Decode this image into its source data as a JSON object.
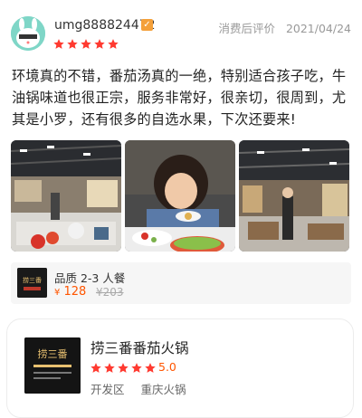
{
  "review": {
    "username": "umg888824472",
    "badge_icon": "vip-badge-icon",
    "meta_label": "消费后评价",
    "date": "2021/04/24",
    "rating": 5,
    "text": "环境真的不错，番茄汤真的一绝，特别适合孩子吃，牛油锅味道也很正宗，服务非常好，很亲切，很周到，尤其是小罗，还有很多的自选水果，下次还要来!",
    "photos": [
      "restaurant-interior-photo",
      "child-eating-photo",
      "dining-hall-photo"
    ]
  },
  "deal": {
    "title": "品质 2-3 人餐",
    "currency": "¥",
    "price": "128",
    "original_price": "¥203",
    "thumb_text": "捞三番"
  },
  "shop": {
    "name": "捞三番番茄火锅",
    "logo_text": "捞三番",
    "rating": 5,
    "score": "5.0",
    "district": "开发区",
    "category": "重庆火锅"
  },
  "colors": {
    "star": "#ff3a30",
    "price": "#ff5500",
    "badge": "#f4a03a"
  }
}
